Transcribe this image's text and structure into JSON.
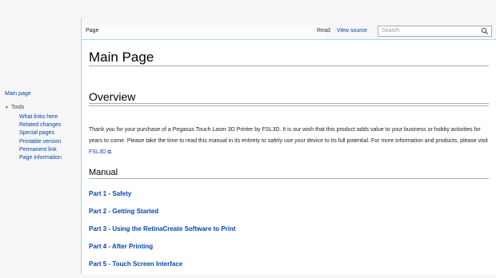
{
  "sidebar": {
    "main_page": "Main page",
    "tools_heading": "Tools",
    "tools": [
      "What links here",
      "Related changes",
      "Special pages",
      "Printable version",
      "Permanent link",
      "Page information"
    ]
  },
  "header": {
    "tab_page": "Page",
    "tab_read": "Read",
    "tab_view_source": "View source",
    "search_placeholder": "Search"
  },
  "content": {
    "title": "Main Page",
    "overview_heading": "Overview",
    "intro_text": "Thank you for your purchase of a Pegasus Touch Laser 3D Printer by FSL3D. It is our wish that this product adds value to your business or hobby activities for years to come. Please take the time to read this manual in its entirety to safely use your device to its full potential. For more information and products, please visit ",
    "intro_link": "FSL3D",
    "manual_heading": "Manual",
    "parts": [
      "Part 1 - Safety",
      "Part 2 - Getting Started",
      "Part 3 - Using the RetinaCreate Software to Print",
      "Part 4 - After Printing",
      "Part 5 - Touch Screen Interface"
    ]
  },
  "colors": {
    "link": "#0645ad",
    "border_blue": "#a7d7f9"
  }
}
